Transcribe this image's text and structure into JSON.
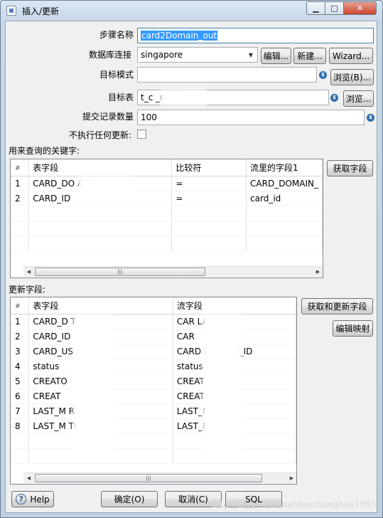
{
  "window": {
    "title": "插入/更新",
    "min_glyph": "▁",
    "max_glyph": "□",
    "close_glyph": "✕"
  },
  "form": {
    "step_name_label": "步骤名称",
    "step_name_value": "card2Domain_out",
    "db_conn_label": "数据库连接",
    "db_conn_value": "singapore",
    "edit_btn": "编辑...",
    "new_btn": "新建...",
    "wizard_btn": "Wizard...",
    "target_schema_label": "目标模式",
    "target_schema_value": "",
    "browse_schema_btn": "浏览(B)...",
    "target_table_label": "目标表",
    "target_table_value": "t_c          _relation",
    "browse_table_btn": "浏览...",
    "commit_size_label": "提交记录数量",
    "commit_size_value": "100",
    "no_update_label": "不执行任何更新:",
    "var_icon": "$"
  },
  "keys": {
    "section_label": "用来查询的关键字:",
    "get_fields_btn": "获取字段",
    "columns": [
      "#",
      "表字段",
      "比较符",
      "流里的字段1"
    ],
    "rows": [
      [
        "1",
        "CARD_DO          ATION_ID",
        "=",
        "CARD_DOMAIN_"
      ],
      [
        "2",
        "CARD_ID",
        "=",
        "card_id"
      ]
    ]
  },
  "updates": {
    "section_label": "更新字段:",
    "get_update_fields_btn": "获取和更新字段",
    "edit_mapping_btn": "编辑映射",
    "columns": [
      "#",
      "表字段",
      "流字段"
    ],
    "rows": [
      [
        "1",
        "CARD_D         TION_ID",
        "CAR           LATION_I"
      ],
      [
        "2",
        "CARD_ID",
        "CAR"
      ],
      [
        "3",
        "CARD_US        AIN_ID",
        "CARD         DOMAIN_ID"
      ],
      [
        "4",
        "status",
        "status"
      ],
      [
        "5",
        "CREATO",
        "CREAT"
      ],
      [
        "6",
        "CREAT",
        "CREAT      E"
      ],
      [
        "7",
        "LAST_M       R",
        "LAST_M         ER"
      ],
      [
        "8",
        "LAST_M        TIME",
        "LAST_M       _TIME"
      ]
    ]
  },
  "footer": {
    "help_btn": "Help",
    "help_icon": "?",
    "ok_btn": "确定(O)",
    "cancel_btn": "取消(C)",
    "sql_btn": "SQL",
    "watermark": "http://blog.csdn.net/fouzhanghao1993"
  },
  "scroll": {
    "left_arrow": "◀",
    "right_arrow": "▶",
    "thumb_grip": "|||"
  }
}
